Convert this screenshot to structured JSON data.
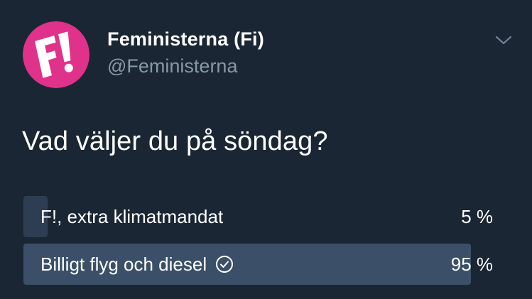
{
  "tweet": {
    "author": {
      "display_name": "Feministerna (Fi)",
      "handle": "@Feministerna",
      "avatar_logo_text": "F!",
      "avatar_color": "#e0328a"
    },
    "menu_icon": "chevron-down-icon",
    "text": "Vad väljer du på söndag?"
  },
  "poll": {
    "options": [
      {
        "label": "F!, extra klimatmandat",
        "percent_label": "5 %",
        "percent": 5,
        "selected": false
      },
      {
        "label": "Billigt flyg och diesel",
        "percent_label": "95 %",
        "percent": 95,
        "selected": true,
        "selected_icon": "check-circle-icon"
      }
    ]
  },
  "colors": {
    "background": "#1b2634",
    "text_primary": "#ffffff",
    "text_secondary": "#8899a6",
    "bar_normal": "#2e3e52",
    "bar_selected": "#3b5068"
  }
}
